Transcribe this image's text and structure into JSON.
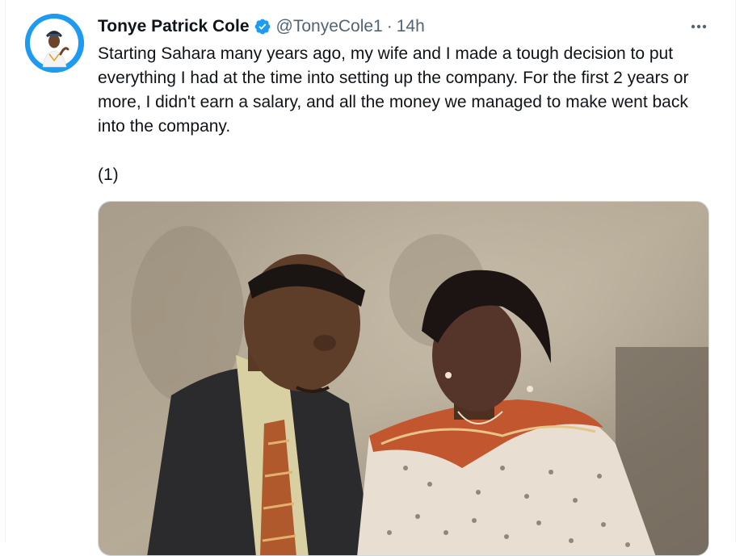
{
  "tweet": {
    "author": {
      "display_name": "Tonye Patrick Cole",
      "handle": "@TonyeCole1",
      "verified": true
    },
    "separator": "·",
    "time": "14h",
    "text": "Starting Sahara many years ago, my wife and I made a tough decision to put everything I had at the time into setting up the company. For the first 2 years or more, I didn't earn a salary, and all the money we managed to make went back into the company.\n\n(1)",
    "more_icon": "more-horizontal-icon",
    "verified_icon": "verified-badge-icon"
  },
  "colors": {
    "text": "#0f1419",
    "secondary": "#536471",
    "accent": "#1d9bf0",
    "border": "#cfd9de"
  }
}
